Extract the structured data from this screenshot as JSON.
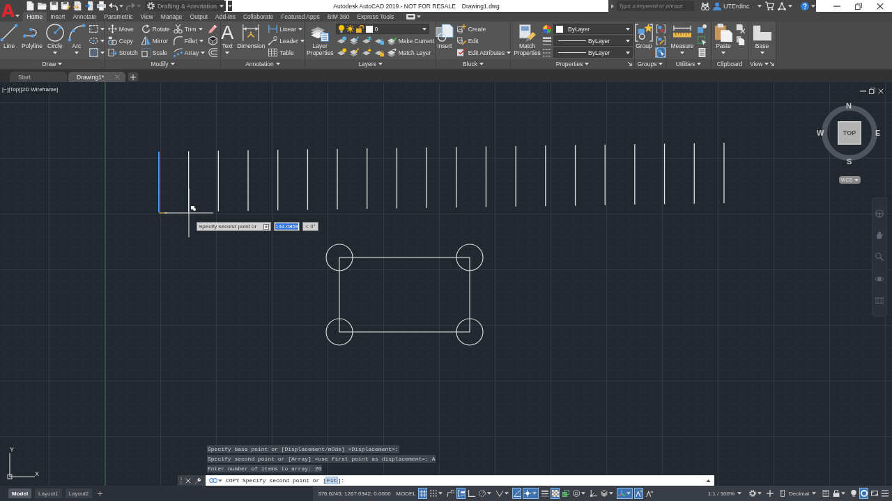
{
  "title_bar": {
    "app_logo": "A",
    "quick_access": [
      {
        "kind": "new",
        "dropdown": false,
        "disabled": false
      },
      {
        "kind": "open",
        "dropdown": false,
        "disabled": false
      },
      {
        "kind": "save",
        "dropdown": false,
        "disabled": false
      },
      {
        "kind": "saveas",
        "dropdown": false,
        "disabled": false
      },
      {
        "kind": "webopen",
        "dropdown": false,
        "disabled": false
      },
      {
        "kind": "websave",
        "dropdown": false,
        "disabled": false
      },
      {
        "kind": "plot",
        "dropdown": false,
        "disabled": false
      },
      {
        "kind": "undo",
        "dropdown": true,
        "disabled": false
      },
      {
        "kind": "redo",
        "dropdown": true,
        "disabled": true
      }
    ],
    "workspace": {
      "value": "Drafting & Annotation",
      "disabled": true
    },
    "title": "Autodesk AutoCAD 2019 - NOT FOR RESALE",
    "file_name": "Drawing1.dwg",
    "search": {
      "placeholder": "Type a keyword or phrase"
    },
    "user": "UTErdinc"
  },
  "ribbon_tabs": [
    {
      "label": "Home",
      "selected": true
    },
    {
      "label": "Insert",
      "selected": false
    },
    {
      "label": "Annotate",
      "selected": false
    },
    {
      "label": "Parametric",
      "selected": false
    },
    {
      "label": "View",
      "selected": false
    },
    {
      "label": "Manage",
      "selected": false
    },
    {
      "label": "Output",
      "selected": false
    },
    {
      "label": "Add-ins",
      "selected": false
    },
    {
      "label": "Collaborate",
      "selected": false
    },
    {
      "label": "Featured Apps",
      "selected": false
    },
    {
      "label": "BIM 360",
      "selected": false
    },
    {
      "label": "Express Tools",
      "selected": false
    }
  ],
  "ribbon_panels": [
    {
      "title": "Draw",
      "menu": true,
      "launcher": false,
      "columns": [
        {
          "kind": "large",
          "tool": {
            "kind": "line",
            "label": "Line",
            "dropdown": false
          }
        },
        {
          "kind": "large",
          "tool": {
            "kind": "polyline",
            "label": "Polyline",
            "dropdown": false
          }
        },
        {
          "kind": "large",
          "tool": {
            "kind": "circle",
            "label": "Circle",
            "dropdown": true
          }
        },
        {
          "kind": "large",
          "tool": {
            "kind": "arc",
            "label": "Arc",
            "dropdown": true
          }
        },
        {
          "kind": "stack",
          "rows": [
            {
              "tools": [
                {
                  "kind": "rectangle",
                  "dropdown": true
                }
              ]
            },
            {
              "tools": [
                {
                  "kind": "ellipse",
                  "dropdown": true
                }
              ]
            },
            {
              "tools": [
                {
                  "kind": "hatch",
                  "dropdown": true
                }
              ]
            }
          ]
        }
      ]
    },
    {
      "title": "Modify",
      "menu": true,
      "launcher": false,
      "columns": [
        {
          "kind": "stack",
          "rows": [
            {
              "tools": [
                {
                  "kind": "move",
                  "label": "Move",
                  "dropdown": false
                }
              ]
            },
            {
              "tools": [
                {
                  "kind": "copy",
                  "label": "Copy",
                  "dropdown": false
                }
              ]
            },
            {
              "tools": [
                {
                  "kind": "stretch",
                  "label": "Stretch",
                  "dropdown": false
                }
              ]
            }
          ]
        },
        {
          "kind": "stack",
          "rows": [
            {
              "tools": [
                {
                  "kind": "rotate",
                  "label": "Rotate",
                  "dropdown": false
                }
              ]
            },
            {
              "tools": [
                {
                  "kind": "mirror",
                  "label": "Mirror",
                  "dropdown": false
                }
              ]
            },
            {
              "tools": [
                {
                  "kind": "scale",
                  "label": "Scale",
                  "dropdown": false
                }
              ]
            }
          ]
        },
        {
          "kind": "stack",
          "rows": [
            {
              "tools": [
                {
                  "kind": "trim",
                  "label": "Trim",
                  "dropdown": true
                }
              ]
            },
            {
              "tools": [
                {
                  "kind": "fillet",
                  "label": "Fillet",
                  "dropdown": true
                }
              ]
            },
            {
              "tools": [
                {
                  "kind": "array",
                  "label": "Array",
                  "dropdown": true
                }
              ]
            }
          ]
        },
        {
          "kind": "stack",
          "rows": [
            {
              "tools": [
                {
                  "kind": "erase",
                  "dropdown": false
                }
              ]
            },
            {
              "tools": [
                {
                  "kind": "explode",
                  "dropdown": false
                }
              ]
            },
            {
              "tools": [
                {
                  "kind": "offset",
                  "dropdown": false
                }
              ]
            }
          ]
        }
      ]
    },
    {
      "title": "Annotation",
      "menu": true,
      "launcher": false,
      "columns": [
        {
          "kind": "large",
          "tool": {
            "kind": "text",
            "glyph": "A",
            "label": "Text",
            "dropdown": true
          }
        },
        {
          "kind": "large",
          "tool": {
            "kind": "dimension",
            "label": "Dimension",
            "dropdown": false
          }
        },
        {
          "kind": "stack",
          "rows": [
            {
              "tools": [
                {
                  "kind": "linear",
                  "label": "Linear",
                  "dropdown": true
                }
              ]
            },
            {
              "tools": [
                {
                  "kind": "leader",
                  "label": "Leader",
                  "dropdown": true
                }
              ]
            },
            {
              "tools": [
                {
                  "kind": "table",
                  "label": "Table",
                  "dropdown": false
                }
              ]
            }
          ]
        }
      ]
    },
    {
      "title": "Layers",
      "menu": true,
      "launcher": false,
      "columns": [
        {
          "kind": "large",
          "tool": {
            "kind": "layprop",
            "label": "Layer Properties",
            "dropdown": false
          }
        },
        {
          "kind": "stack",
          "rows": [
            {
              "tools": [
                {
                  "kind": "layercombo",
                  "value": "0",
                  "dropdown": true
                }
              ]
            },
            {
              "tools": [
                {
                  "kind": "layoff"
                },
                {
                  "kind": "layiso"
                },
                {
                  "kind": "layfrz"
                },
                {
                  "kind": "laylck"
                },
                {
                  "kind": "laycur",
                  "label": "Make Current"
                }
              ]
            },
            {
              "tools": [
                {
                  "kind": "layon"
                },
                {
                  "kind": "layuniso"
                },
                {
                  "kind": "laythw"
                },
                {
                  "kind": "layulk"
                },
                {
                  "kind": "laymch",
                  "label": "Match Layer"
                }
              ]
            }
          ]
        }
      ]
    },
    {
      "title": "Block",
      "menu": true,
      "launcher": false,
      "columns": [
        {
          "kind": "large",
          "tool": {
            "kind": "insert",
            "label": "Insert",
            "dropdown": false
          }
        },
        {
          "kind": "stack",
          "rows": [
            {
              "tools": [
                {
                  "kind": "create",
                  "label": "Create",
                  "dropdown": false
                }
              ]
            },
            {
              "tools": [
                {
                  "kind": "edit",
                  "label": "Edit",
                  "dropdown": false
                }
              ]
            },
            {
              "tools": [
                {
                  "kind": "editattr",
                  "label": "Edit Attributes",
                  "dropdown": true
                }
              ]
            }
          ]
        }
      ]
    },
    {
      "title": "Properties",
      "menu": true,
      "launcher": true,
      "columns": [
        {
          "kind": "large",
          "tool": {
            "kind": "matchprop",
            "label": "Match Properties",
            "dropdown": false
          }
        },
        {
          "kind": "stack",
          "rows": [
            {
              "tools": [
                {
                  "kind": "colorwheel"
                },
                {
                  "kind": "colorcombo",
                  "value": "ByLayer",
                  "dropdown": true
                }
              ]
            },
            {
              "tools": [
                {
                  "kind": "lineweight"
                },
                {
                  "kind": "linecombo",
                  "value": "ByLayer",
                  "dropdown": true
                }
              ]
            },
            {
              "tools": [
                {
                  "kind": "linetype"
                },
                {
                  "kind": "linecombo",
                  "value": "ByLayer",
                  "dropdown": true
                }
              ]
            }
          ]
        }
      ]
    },
    {
      "title": "Groups",
      "menu": true,
      "launcher": false,
      "columns": [
        {
          "kind": "large",
          "tool": {
            "kind": "group",
            "label": "Group",
            "dropdown": false
          }
        },
        {
          "kind": "stack",
          "rows": [
            {
              "tools": [
                {
                  "kind": "ungroup",
                  "on": false
                }
              ]
            },
            {
              "tools": [
                {
                  "kind": "groupedit",
                  "on": false
                }
              ]
            },
            {
              "tools": [
                {
                  "kind": "groupsel",
                  "on": true
                }
              ]
            }
          ]
        }
      ]
    },
    {
      "title": "Utilities",
      "menu": true,
      "launcher": false,
      "columns": [
        {
          "kind": "large",
          "tool": {
            "kind": "measure",
            "label": "Measure",
            "dropdown": true
          }
        },
        {
          "kind": "stack",
          "rows": [
            {
              "tools": [
                {
                  "kind": "idpoint"
                }
              ]
            },
            {
              "tools": [
                {
                  "kind": "selectall"
                }
              ]
            },
            {
              "tools": [
                {
                  "kind": "list"
                }
              ]
            }
          ]
        }
      ]
    },
    {
      "title": "Clipboard",
      "menu": false,
      "launcher": false,
      "columns": [
        {
          "kind": "large",
          "tool": {
            "kind": "paste",
            "label": "Paste",
            "dropdown": true
          }
        },
        {
          "kind": "stack",
          "rows": [
            {
              "tools": [
                {
                  "kind": "cut"
                }
              ]
            },
            {
              "tools": [
                {
                  "kind": "copyclip"
                }
              ]
            }
          ]
        }
      ]
    },
    {
      "title": "View",
      "menu": true,
      "launcher": true,
      "columns": [
        {
          "kind": "large",
          "tool": {
            "kind": "base",
            "label": "Base",
            "dropdown": true
          }
        }
      ]
    }
  ],
  "file_tabs": [
    {
      "label": "Start",
      "selected": false,
      "closable": false
    },
    {
      "label": "Drawing1*",
      "selected": true,
      "closable": true
    }
  ],
  "viewport": {
    "controls": [
      "[−]",
      "[Top]",
      "[2D Wireframe]"
    ]
  },
  "viewcube": {
    "face": "TOP",
    "north": "N",
    "east": "E",
    "south": "S",
    "west": "W",
    "ucs": "WCS"
  },
  "drawing": {
    "lines": [
      {
        "selected": true
      },
      {
        "selected": false
      },
      {
        "selected": false
      },
      {
        "selected": false
      },
      {
        "selected": false
      },
      {
        "selected": false
      },
      {
        "selected": false
      },
      {
        "selected": false
      },
      {
        "selected": false
      },
      {
        "selected": false
      },
      {
        "selected": false
      },
      {
        "selected": false
      },
      {
        "selected": false
      },
      {
        "selected": false
      },
      {
        "selected": false
      },
      {
        "selected": false
      },
      {
        "selected": false
      },
      {
        "selected": false
      },
      {
        "selected": false
      },
      {
        "selected": false
      }
    ]
  },
  "dynamic_input": {
    "prompt": "Specify second point or",
    "distance": "134.0869",
    "distance_selected": true,
    "angle": "< 3°"
  },
  "ucs_icon": {
    "x": "X",
    "y": "Y"
  },
  "command_history": [
    "Specify base point or [Displacement/mOde] <Displacement>:",
    "Specify second point or [Array] <use first point as displacement>: A",
    "Enter number of items to array: 20"
  ],
  "command_line": {
    "text": "COPY Specify second point or [",
    "options": [
      {
        "label": "Fit",
        "highlighted": true
      }
    ],
    "text_end": "]:"
  },
  "status_bar": {
    "layout_tabs": [
      {
        "label": "Model",
        "selected": true
      },
      {
        "label": "Layout1",
        "selected": false
      },
      {
        "label": "Layout2",
        "selected": false
      }
    ],
    "items": [
      {
        "kind": "coordinates",
        "text": "376.6245, 1267.0342, 0.0000",
        "on": false,
        "dropdown": false
      },
      {
        "kind": "space",
        "text": "MODEL",
        "on": false,
        "dropdown": false
      },
      {
        "kind": "grid",
        "on": true,
        "dropdown": false
      },
      {
        "kind": "snap",
        "on": false,
        "dropdown": true
      },
      {
        "kind": "infer",
        "on": false,
        "dropdown": false
      },
      {
        "kind": "dyninput",
        "on": true,
        "dropdown": false
      },
      {
        "kind": "ortho",
        "on": false,
        "dropdown": false
      },
      {
        "kind": "polar",
        "on": false,
        "dropdown": true
      },
      {
        "kind": "isodraft",
        "on": false,
        "dropdown": true
      },
      {
        "kind": "otrack",
        "on": true,
        "dropdown": false
      },
      {
        "kind": "osnap",
        "on": true,
        "dropdown": true
      },
      {
        "kind": "lineweight",
        "on": false,
        "dropdown": false
      },
      {
        "kind": "transparency",
        "on": true,
        "dropdown": false
      },
      {
        "kind": "selcycle",
        "on": false,
        "dropdown": false
      },
      {
        "kind": "osnap3d",
        "on": false,
        "dropdown": true
      },
      {
        "kind": "dynucs",
        "on": false,
        "dropdown": false
      },
      {
        "kind": "selfilter",
        "on": false,
        "dropdown": true
      },
      {
        "kind": "gizmo",
        "on": true,
        "dropdown": true
      },
      {
        "kind": "annovis",
        "on": true,
        "dropdown": false
      },
      {
        "kind": "autoscale",
        "on": false,
        "dropdown": false
      },
      {
        "kind": "scale",
        "text": "1:1 / 100%",
        "on": false,
        "dropdown": true
      },
      {
        "kind": "workspace",
        "on": false,
        "dropdown": true
      },
      {
        "kind": "monitor",
        "on": false,
        "dropdown": false
      },
      {
        "kind": "units",
        "text": "Decimal",
        "on": false,
        "dropdown": true
      },
      {
        "kind": "quickprops",
        "on": false,
        "dropdown": false
      },
      {
        "kind": "lockui",
        "on": false,
        "dropdown": true
      },
      {
        "kind": "isolate",
        "on": false,
        "dropdown": false
      },
      {
        "kind": "graphics",
        "on": true,
        "dropdown": false
      },
      {
        "kind": "cleanscreen",
        "on": false,
        "dropdown": false
      },
      {
        "kind": "customize",
        "on": false,
        "dropdown": false
      }
    ]
  }
}
